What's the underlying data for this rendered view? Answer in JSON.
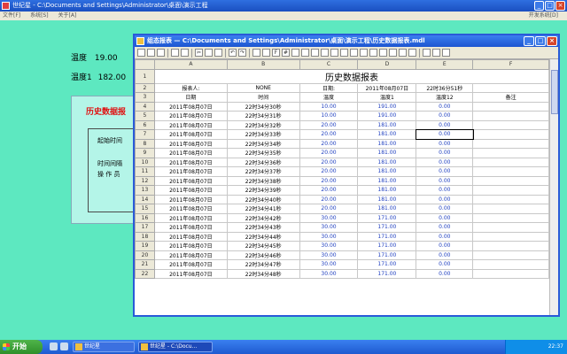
{
  "app": {
    "title": "世纪星 - C:\\Documents and Settings\\Administrator\\桌面\\演示工程",
    "menu": [
      "文件[F]",
      "系统[S]",
      "关于[A]"
    ],
    "menu_right": "开发系统[D]"
  },
  "background": {
    "temp_label": "温度",
    "temp_value": "19.00",
    "humidity_label": "温度1",
    "humidity_value": "182.00",
    "panel_title": "历史数据报",
    "panel_start": "起始时间",
    "panel_interval": "时间间隔",
    "panel_operator": "操 作 员"
  },
  "window": {
    "title": "组态报表 — C:\\Documents and Settings\\Administrator\\桌面\\演示工程\\历史数据报表.mdl",
    "min": "_",
    "max": "□",
    "close": "×"
  },
  "sheet": {
    "columns": [
      "A",
      "B",
      "C",
      "D",
      "E",
      "F"
    ],
    "title": "历史数据报表",
    "header_row": [
      "报表人:",
      "NONE",
      "日期:",
      "2011年08月07日",
      "22时36分51秒",
      ""
    ],
    "col_headers": [
      "日期",
      "时间",
      "温度",
      "温度1",
      "温度12",
      "备注"
    ],
    "rows": [
      [
        "2011年08月07日",
        "22时34分30秒",
        "10.00",
        "191.00",
        "0.00"
      ],
      [
        "2011年08月07日",
        "22时34分31秒",
        "10.00",
        "191.00",
        "0.00"
      ],
      [
        "2011年08月07日",
        "22时34分32秒",
        "20.00",
        "181.00",
        "0.00"
      ],
      [
        "2011年08月07日",
        "22时34分33秒",
        "20.00",
        "181.00",
        "0.00"
      ],
      [
        "2011年08月07日",
        "22时34分34秒",
        "20.00",
        "181.00",
        "0.00"
      ],
      [
        "2011年08月07日",
        "22时34分35秒",
        "20.00",
        "181.00",
        "0.00"
      ],
      [
        "2011年08月07日",
        "22时34分36秒",
        "20.00",
        "181.00",
        "0.00"
      ],
      [
        "2011年08月07日",
        "22时34分37秒",
        "20.00",
        "181.00",
        "0.00"
      ],
      [
        "2011年08月07日",
        "22时34分38秒",
        "20.00",
        "181.00",
        "0.00"
      ],
      [
        "2011年08月07日",
        "22时34分39秒",
        "20.00",
        "181.00",
        "0.00"
      ],
      [
        "2011年08月07日",
        "22时34分40秒",
        "20.00",
        "181.00",
        "0.00"
      ],
      [
        "2011年08月07日",
        "22时34分41秒",
        "20.00",
        "181.00",
        "0.00"
      ],
      [
        "2011年08月07日",
        "22时34分42秒",
        "30.00",
        "171.00",
        "0.00"
      ],
      [
        "2011年08月07日",
        "22时34分43秒",
        "30.00",
        "171.00",
        "0.00"
      ],
      [
        "2011年08月07日",
        "22时34分44秒",
        "30.00",
        "171.00",
        "0.00"
      ],
      [
        "2011年08月07日",
        "22时34分45秒",
        "30.00",
        "171.00",
        "0.00"
      ],
      [
        "2011年08月07日",
        "22时34分46秒",
        "30.00",
        "171.00",
        "0.00"
      ],
      [
        "2011年08月07日",
        "22时34分47秒",
        "30.00",
        "171.00",
        "0.00"
      ],
      [
        "2011年08月07日",
        "22时34分48秒",
        "30.00",
        "171.00",
        "0.00"
      ]
    ]
  },
  "taskbar": {
    "start": "开始",
    "tasks": [
      "世纪星",
      "世纪星 - C:\\Docu..."
    ],
    "clock": "22:37"
  }
}
